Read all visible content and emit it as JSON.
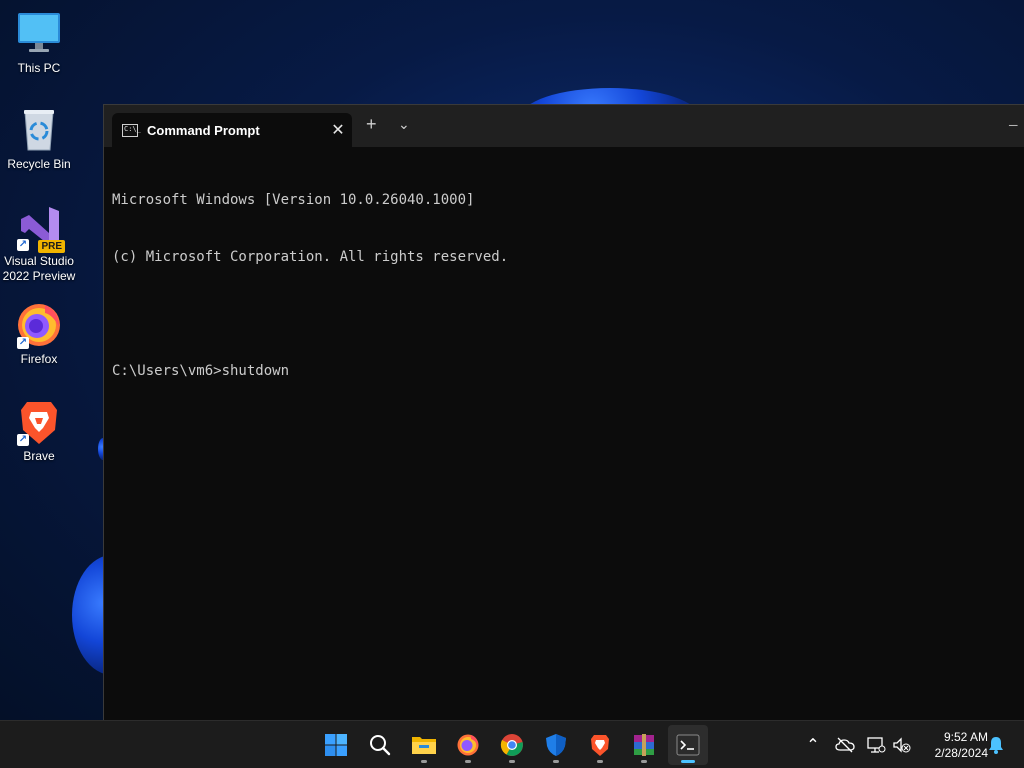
{
  "desktop": {
    "icons": [
      {
        "label": "This PC"
      },
      {
        "label": "Recycle Bin"
      },
      {
        "label": "Visual Studio 2022 Preview",
        "badge": "PRE"
      },
      {
        "label": "Firefox"
      },
      {
        "label": "Brave"
      }
    ]
  },
  "terminal": {
    "tab_title": "Command Prompt",
    "tab_icon_text": "C:\\_",
    "new_tab_glyph": "+",
    "dropdown_glyph": "⌄",
    "close_glyph": "✕",
    "minimize_glyph": "─",
    "lines": [
      "Microsoft Windows [Version 10.0.26040.1000]",
      "(c) Microsoft Corporation. All rights reserved.",
      "",
      "C:\\Users\\vm6>shutdown"
    ]
  },
  "taskbar": {
    "apps": [
      {
        "name": "start-icon"
      },
      {
        "name": "search-icon"
      },
      {
        "name": "file-explorer-icon"
      },
      {
        "name": "firefox-icon"
      },
      {
        "name": "chrome-icon"
      },
      {
        "name": "defender-icon"
      },
      {
        "name": "brave-icon"
      },
      {
        "name": "winrar-icon"
      },
      {
        "name": "terminal-icon"
      }
    ],
    "tray": {
      "chevron_glyph": "⌃"
    },
    "clock": {
      "time": "9:52 AM",
      "date": "2/28/2024"
    }
  },
  "colors": {
    "accent": "#4cc2ff",
    "terminal_bg": "#0c0c0c",
    "terminal_text": "#cccccc",
    "taskbar_bg": "#1c1c1c"
  }
}
